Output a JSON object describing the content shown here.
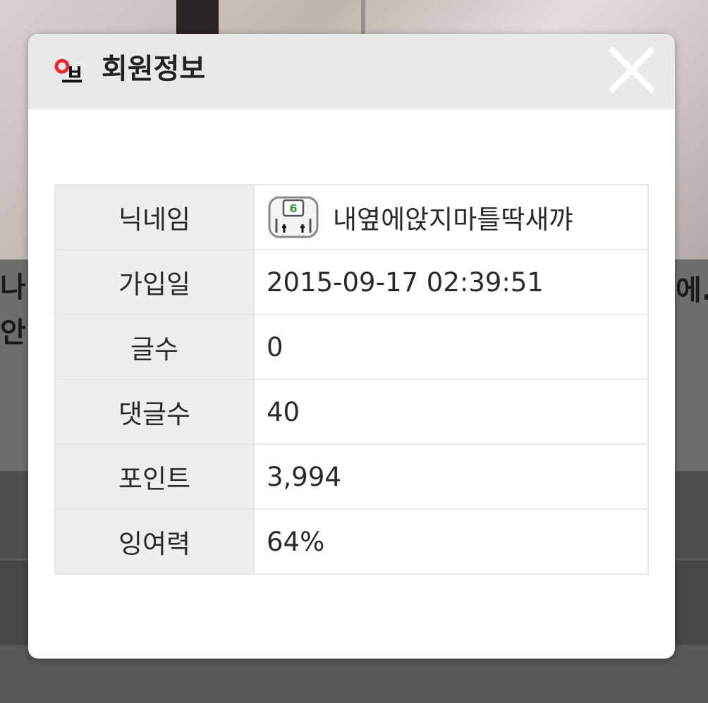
{
  "modal": {
    "title": "회원정보"
  },
  "member_info": {
    "rows": [
      {
        "label": "닉네임",
        "value": "내옆에앉지마틀딱새꺄",
        "level_badge": "6"
      },
      {
        "label": "가입일",
        "value": "2015-09-17 02:39:51"
      },
      {
        "label": "글수",
        "value": "0"
      },
      {
        "label": "댓글수",
        "value": "40"
      },
      {
        "label": "포인트",
        "value": "3,994"
      },
      {
        "label": "잉여력",
        "value": "64%"
      }
    ]
  },
  "background": {
    "fragments": [
      "나",
      "안",
      "에..."
    ]
  },
  "colors": {
    "header_bg": "#e9e9e9",
    "label_bg": "#eeeeee",
    "border": "#e6e6e6",
    "title_icon_red": "#e8282e",
    "level_green": "#3a9a3a"
  }
}
